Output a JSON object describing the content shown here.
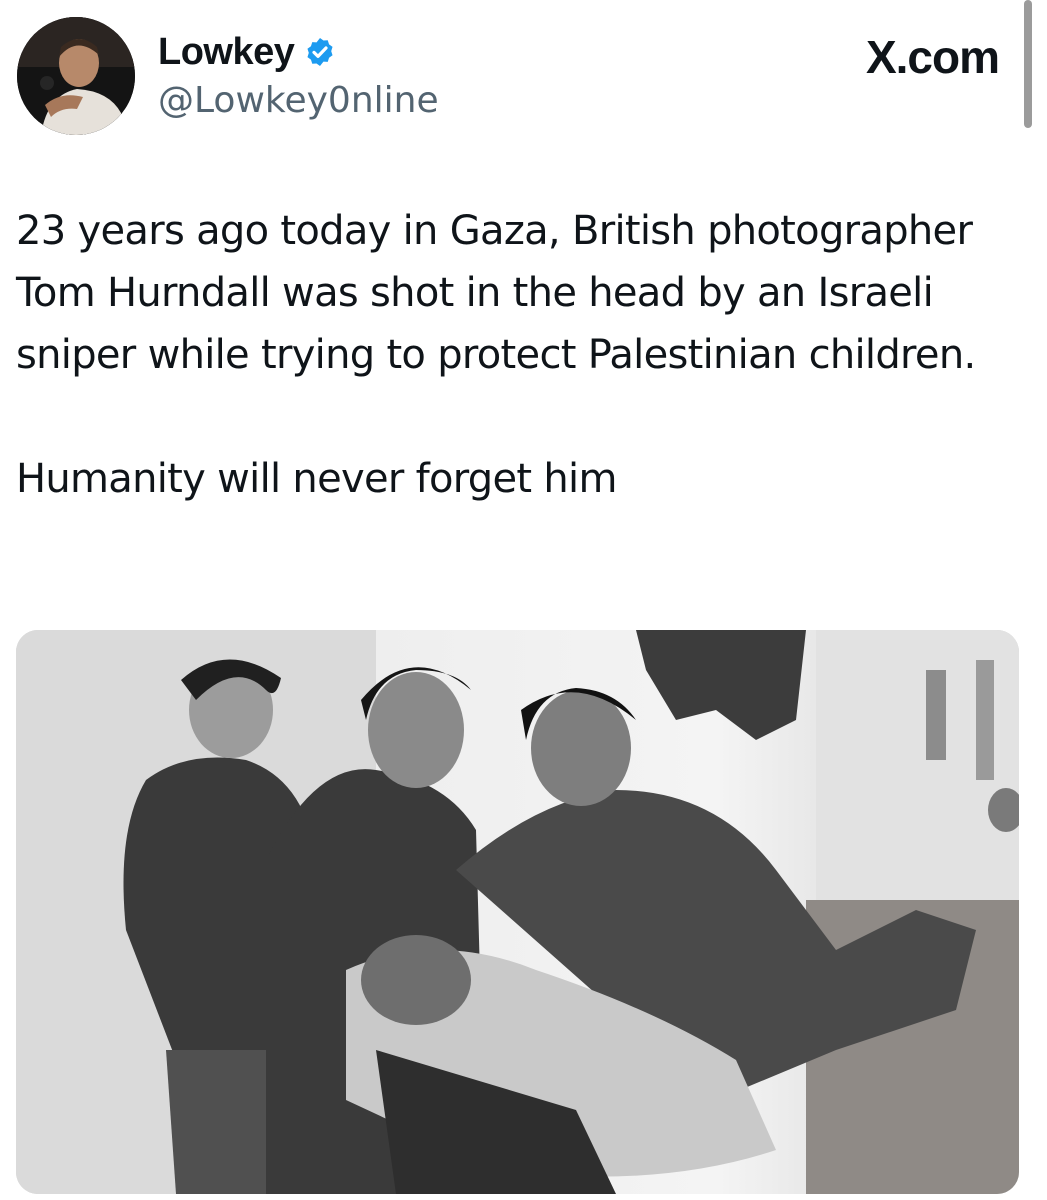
{
  "author": {
    "display_name": "Lowkey",
    "handle": "@Lowkey0nline",
    "verified": true,
    "verified_icon": "verified-badge-icon",
    "verified_color": "#1d9bf0"
  },
  "site_label": "X.com",
  "tweet": {
    "text": "23 years ago today in Gaza, British photographer Tom Hurndall was shot in the head by an Israeli sniper while trying to protect Palestinian children.\n\nHumanity will never forget him"
  },
  "colors": {
    "text_primary": "#0f1419",
    "text_secondary": "#536471"
  }
}
